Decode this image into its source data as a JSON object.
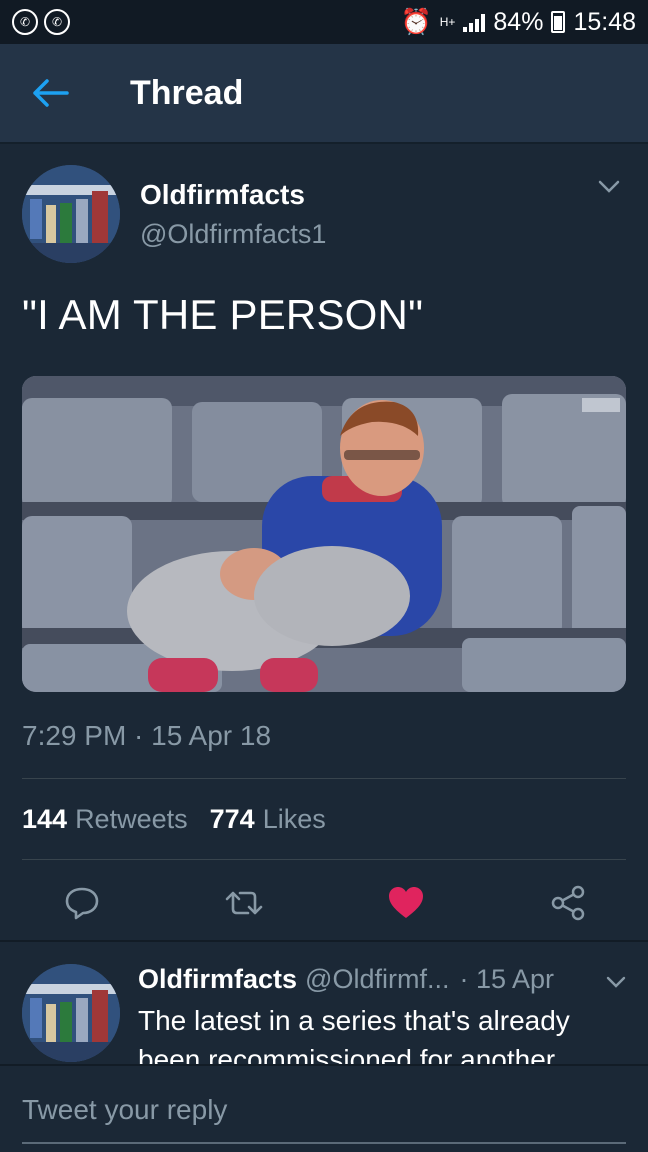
{
  "status_bar": {
    "network": "H+",
    "battery": "84%",
    "time": "15:48"
  },
  "header": {
    "title": "Thread"
  },
  "tweet": {
    "author_name": "Oldfirmfacts",
    "author_handle": "@Oldfirmfacts1",
    "text": "\"I AM THE PERSON\"",
    "timestamp": "7:29 PM · 15 Apr 18",
    "retweets_count": "144",
    "retweets_label": "Retweets",
    "likes_count": "774",
    "likes_label": "Likes",
    "liked": true,
    "colors": {
      "like": "#e0245e",
      "accent": "#1da1f2"
    }
  },
  "reply": {
    "author_name": "Oldfirmfacts",
    "author_handle": "@Oldfirmf...",
    "date": "· 15 Apr",
    "text": "The latest in a series that's already been recommissioned for another"
  },
  "compose": {
    "placeholder": "Tweet your reply"
  }
}
